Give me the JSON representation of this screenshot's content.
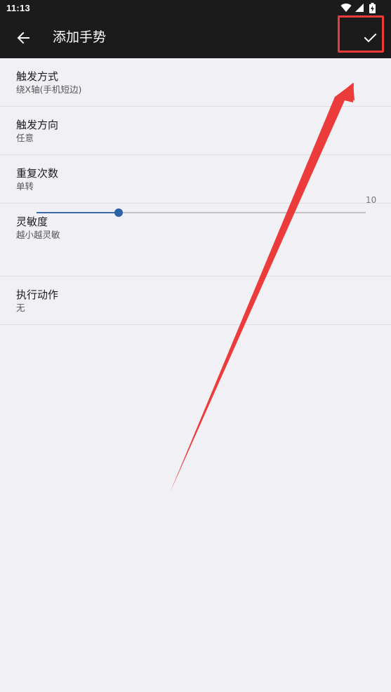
{
  "status_bar": {
    "time": "11:13",
    "icons": [
      "wifi-icon",
      "cellular-signal-icon",
      "battery-charging-icon"
    ]
  },
  "app_bar": {
    "title": "添加手势",
    "back_icon": "arrow-left-icon",
    "confirm_icon": "check-icon"
  },
  "settings": {
    "trigger_mode": {
      "title": "触发方式",
      "summary": "绕X轴(手机短边)"
    },
    "trigger_direction": {
      "title": "触发方向",
      "summary": "任意"
    },
    "repeat_count": {
      "title": "重复次数",
      "summary": "单转"
    },
    "sensitivity": {
      "title": "灵敏度",
      "summary": "越小越灵敏",
      "value_label": "10",
      "slider_fraction": 0.25
    },
    "action": {
      "title": "执行动作",
      "summary": "无"
    }
  },
  "colors": {
    "app_bar": "#1b1b1b",
    "background": "#f1f0f5",
    "accent": "#2f63a8",
    "annotation": "#ec3b3b"
  }
}
